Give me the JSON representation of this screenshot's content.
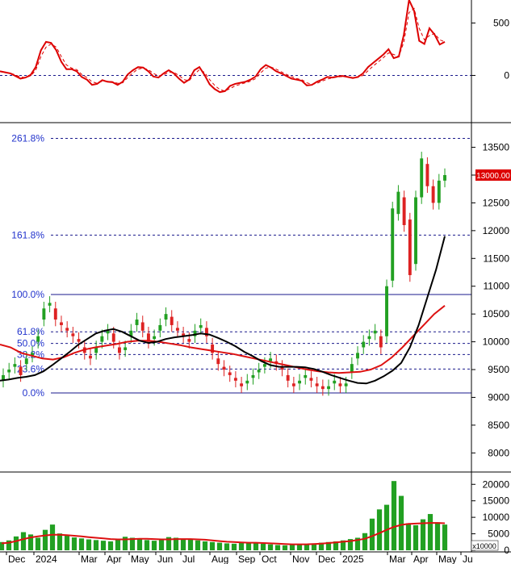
{
  "colors": {
    "background": "#ffffff",
    "candle_up": "#22a022",
    "candle_down": "#dd2222",
    "ma_fast": "#000000",
    "ma_slow": "#dd1111",
    "fib_line": "#1a1a8c",
    "fib_label": "#2233cc",
    "oscillator": "#dd0000",
    "oscillator_signal": "#dd0000",
    "volume_bar": "#22a022",
    "volume_ma": "#dd1111",
    "price_tag_bg": "#dd0000",
    "price_tag_text": "#ffffff",
    "axis": "#000000",
    "zero_line": "#1a1a8c"
  },
  "chart_data": [
    {
      "panel": "oscillator",
      "type": "line",
      "y_ticks": [
        "500",
        "0"
      ],
      "y_tick_values": [
        500,
        0
      ],
      "ylim": [
        -420,
        720
      ],
      "zero_line": true,
      "series": [
        {
          "style": "solid",
          "values": [
            40,
            30,
            20,
            -5,
            -30,
            -20,
            5,
            80,
            240,
            320,
            310,
            240,
            130,
            60,
            60,
            40,
            -15,
            -40,
            -90,
            -80,
            -45,
            -60,
            -65,
            -90,
            -60,
            10,
            50,
            80,
            75,
            40,
            -10,
            -20,
            20,
            50,
            20,
            -30,
            -70,
            -40,
            50,
            80,
            5,
            -85,
            -130,
            -160,
            -150,
            -100,
            -80,
            -70,
            -60,
            -40,
            -10,
            60,
            100,
            75,
            40,
            20,
            -5,
            -30,
            -40,
            -50,
            -95,
            -90,
            -60,
            -40,
            -15,
            -20,
            -10,
            -5,
            -15,
            -25,
            -15,
            20,
            80,
            120,
            160,
            200,
            250,
            165,
            180,
            390,
            720,
            615,
            330,
            300,
            450,
            390,
            295,
            320
          ]
        },
        {
          "style": "dashed",
          "values": [
            35,
            30,
            22,
            5,
            -15,
            -20,
            -5,
            50,
            180,
            270,
            300,
            270,
            180,
            100,
            70,
            55,
            10,
            -20,
            -60,
            -75,
            -55,
            -55,
            -60,
            -75,
            -70,
            -20,
            25,
            60,
            70,
            55,
            20,
            -5,
            5,
            30,
            30,
            0,
            -40,
            -50,
            10,
            55,
            30,
            -40,
            -95,
            -135,
            -150,
            -125,
            -100,
            -85,
            -70,
            -55,
            -30,
            25,
            70,
            80,
            60,
            35,
            10,
            -10,
            -30,
            -40,
            -70,
            -85,
            -75,
            -55,
            -35,
            -25,
            -15,
            -10,
            -12,
            -20,
            -18,
            0,
            45,
            90,
            130,
            170,
            215,
            200,
            180,
            320,
            600,
            640,
            450,
            340,
            380,
            400,
            340,
            320
          ]
        }
      ]
    },
    {
      "panel": "price",
      "type": "candlestick",
      "ylim": [
        7700,
        13900
      ],
      "y_ticks": [
        "13500",
        "13000",
        "12500",
        "12000",
        "11500",
        "11000",
        "10500",
        "10000",
        "9500",
        "9000",
        "8500",
        "8000"
      ],
      "y_tick_values": [
        13500,
        13000,
        12500,
        12000,
        11500,
        11000,
        10500,
        10000,
        9500,
        9000,
        8500,
        8000
      ],
      "x_labels": [
        "Dec",
        "2024",
        "Mar",
        "Apr",
        "May",
        "Jun",
        "Jul",
        "Aug",
        "Sep",
        "Oct",
        "Nov",
        "Dec",
        "2025",
        "Mar",
        "Apr",
        "May",
        "Ju"
      ],
      "price_tag": "13000.00",
      "price_tag_value": 13000,
      "fibonacci": [
        {
          "label": "261.8%",
          "value": 13660,
          "style": "dashed"
        },
        {
          "label": "161.8%",
          "value": 11920,
          "style": "dashed"
        },
        {
          "label": "100.0%",
          "value": 10850,
          "style": "solid"
        },
        {
          "label": "61.8%",
          "value": 10180,
          "style": "dashed"
        },
        {
          "label": "50.0%",
          "value": 9970,
          "style": "dashed"
        },
        {
          "label": "38.2%",
          "value": 9770,
          "style": "dashed"
        },
        {
          "label": "23.6%",
          "value": 9510,
          "style": "dashed"
        },
        {
          "label": "0.0%",
          "value": 9080,
          "style": "solid"
        }
      ],
      "closes": [
        9400,
        9500,
        9600,
        9400,
        9700,
        9800,
        10100,
        10600,
        10700,
        10400,
        10300,
        10200,
        10100,
        10000,
        9800,
        9700,
        9900,
        10100,
        10200,
        10000,
        9800,
        9900,
        10200,
        10400,
        10200,
        10000,
        10100,
        10300,
        10500,
        10300,
        10200,
        10100,
        10000,
        10200,
        10300,
        10100,
        9800,
        9600,
        9500,
        9400,
        9300,
        9200,
        9300,
        9400,
        9500,
        9600,
        9700,
        9600,
        9500,
        9300,
        9200,
        9300,
        9400,
        9300,
        9200,
        9150,
        9200,
        9300,
        9200,
        9250,
        9600,
        9800,
        10000,
        10100,
        10200,
        9900,
        11000,
        12400,
        12700,
        12100,
        11200,
        12600,
        13300,
        12800,
        12500,
        12900,
        13000
      ],
      "opens": [
        9300,
        9450,
        9550,
        9550,
        9600,
        9750,
        10000,
        10400,
        10650,
        10600,
        10350,
        10250,
        10150,
        10050,
        9900,
        9750,
        9800,
        10000,
        10150,
        10150,
        9900,
        9850,
        10100,
        10300,
        10350,
        10150,
        10050,
        10200,
        10400,
        10450,
        10250,
        10150,
        10050,
        10100,
        10250,
        10250,
        9950,
        9700,
        9550,
        9450,
        9350,
        9250,
        9250,
        9350,
        9450,
        9550,
        9650,
        9650,
        9550,
        9400,
        9250,
        9250,
        9350,
        9350,
        9250,
        9200,
        9150,
        9250,
        9250,
        9200,
        9450,
        9700,
        9900,
        10050,
        10150,
        10100,
        10100,
        11100,
        12300,
        12600,
        12200,
        11400,
        12600,
        13200,
        12800,
        12500,
        12900
      ],
      "ma_fast": [
        9300,
        9320,
        9350,
        9370,
        9400,
        9470,
        9580,
        9700,
        9820,
        9950,
        10050,
        10150,
        10200,
        10230,
        10180,
        10100,
        10020,
        9980,
        10000,
        10050,
        10080,
        10100,
        10120,
        10150,
        10130,
        10070,
        10000,
        9920,
        9820,
        9740,
        9650,
        9580,
        9550,
        9550,
        9550,
        9540,
        9510,
        9460,
        9400,
        9350,
        9300,
        9260,
        9250,
        9300,
        9380,
        9480,
        9620,
        9900,
        10300,
        10800,
        11300,
        11900
      ],
      "ma_slow": [
        9950,
        9900,
        9800,
        9750,
        9700,
        9680,
        9720,
        9800,
        9860,
        9900,
        9930,
        9960,
        10000,
        10020,
        10020,
        10000,
        9970,
        9940,
        9900,
        9870,
        9840,
        9810,
        9780,
        9740,
        9700,
        9660,
        9620,
        9580,
        9540,
        9500,
        9470,
        9450,
        9440,
        9450,
        9460,
        9500,
        9580,
        9720,
        9900,
        10100,
        10300,
        10500,
        10650
      ]
    },
    {
      "panel": "volume",
      "type": "bar",
      "unit_label": "x10000",
      "ylim": [
        0,
        23000
      ],
      "y_ticks": [
        "20000",
        "15000",
        "10000",
        "5000",
        "0"
      ],
      "y_tick_values": [
        20000,
        15000,
        10000,
        5000,
        0
      ],
      "values": [
        2500,
        3000,
        4200,
        5500,
        4800,
        3800,
        6200,
        7800,
        5100,
        4400,
        3900,
        3600,
        3300,
        3100,
        2900,
        2700,
        3400,
        4100,
        3800,
        3600,
        3100,
        2900,
        3300,
        4000,
        3800,
        3500,
        3200,
        3000,
        2700,
        2500,
        2300,
        2100,
        2000,
        2200,
        2400,
        2200,
        2000,
        1800,
        1600,
        1500,
        1600,
        1700,
        1900,
        2100,
        2300,
        2500,
        2700,
        3000,
        3400,
        3800,
        5200,
        9600,
        12400,
        13800,
        21000,
        16500,
        8200,
        7600,
        9400,
        11000,
        8500,
        7800
      ],
      "ma_values": [
        2100,
        2300,
        2800,
        3400,
        3900,
        4200,
        4500,
        4700,
        4700,
        4600,
        4400,
        4200,
        4000,
        3800,
        3600,
        3400,
        3300,
        3300,
        3400,
        3500,
        3500,
        3400,
        3300,
        3300,
        3400,
        3400,
        3400,
        3300,
        3200,
        3000,
        2800,
        2600,
        2500,
        2400,
        2300,
        2300,
        2200,
        2100,
        2000,
        1900,
        1800,
        1800,
        1800,
        1900,
        2000,
        2200,
        2400,
        2600,
        2800,
        3100,
        3500,
        4300,
        5200,
        6200,
        7100,
        7700,
        8000,
        8100,
        8200,
        8300,
        8300,
        8200
      ]
    }
  ]
}
